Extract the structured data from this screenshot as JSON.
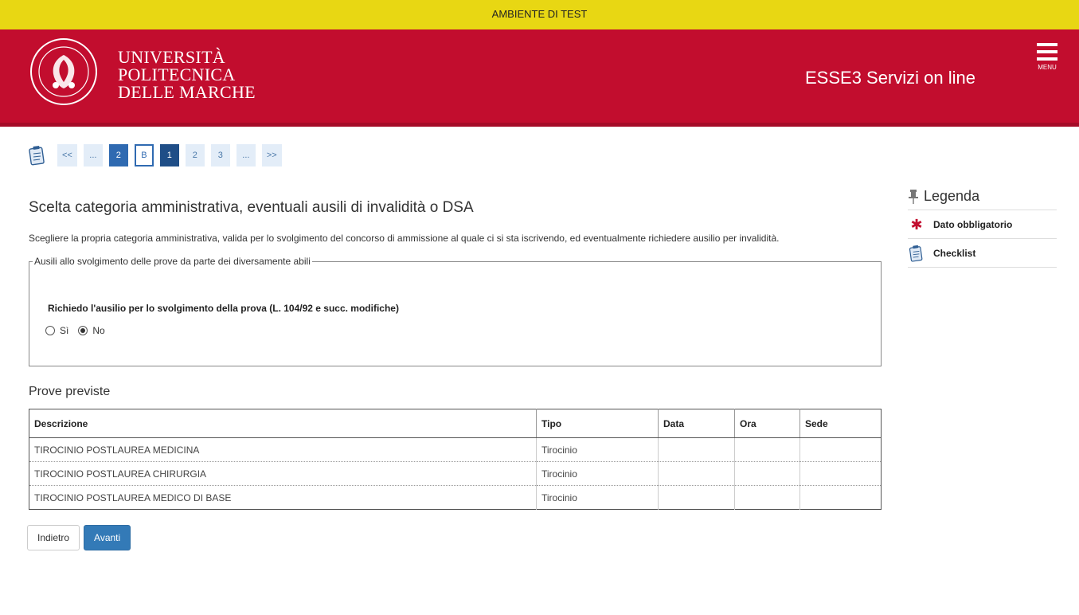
{
  "env": {
    "label": "AMBIENTE DI TEST"
  },
  "header": {
    "university_line1": "UNIVERSITÀ",
    "university_line2": "POLITECNICA",
    "university_line3": "DELLE MARCHE",
    "portal_title": "ESSE3 Servizi on line",
    "menu_label": "MENU"
  },
  "stepper": {
    "icon": "checklist-icon",
    "steps": [
      {
        "label": "<<"
      },
      {
        "label": "..."
      },
      {
        "label": "2"
      },
      {
        "label": "B"
      },
      {
        "label": "1"
      },
      {
        "label": "2"
      },
      {
        "label": "3"
      },
      {
        "label": "..."
      },
      {
        "label": ">>"
      }
    ]
  },
  "main": {
    "title": "Scelta categoria amministrativa, eventuali ausili di invalidità o DSA",
    "intro": "Scegliere la propria categoria amministrativa, valida per lo svolgimento del concorso di ammissione al quale ci si sta iscrivendo, ed eventualmente richiedere ausilio per invalidità.",
    "fieldset_legend": "Ausili allo svolgimento delle prove da parte dei diversamente abili",
    "question": "Richiedo l'ausilio per lo svolgimento della prova (L. 104/92 e succ. modifiche)",
    "options": [
      {
        "label": "Sì",
        "checked": false
      },
      {
        "label": "No",
        "checked": true
      }
    ]
  },
  "prove": {
    "title": "Prove previste",
    "columns": [
      "Descrizione",
      "Tipo",
      "Data",
      "Ora",
      "Sede"
    ],
    "rows": [
      [
        "TIROCINIO POSTLAUREA MEDICINA",
        "Tirocinio",
        "",
        "",
        ""
      ],
      [
        "TIROCINIO POSTLAUREA CHIRURGIA",
        "Tirocinio",
        "",
        "",
        ""
      ],
      [
        "TIROCINIO POSTLAUREA MEDICO DI BASE",
        "Tirocinio",
        "",
        "",
        ""
      ]
    ]
  },
  "actions": {
    "back_label": "Indietro",
    "next_label": "Avanti"
  },
  "legenda": {
    "title": "Legenda",
    "required_label": "Dato obbligatorio",
    "checklist_label": "Checklist"
  },
  "colors": {
    "brand_red": "#c20d2e",
    "env_yellow": "#e8d713",
    "primary_blue": "#337ab7"
  }
}
